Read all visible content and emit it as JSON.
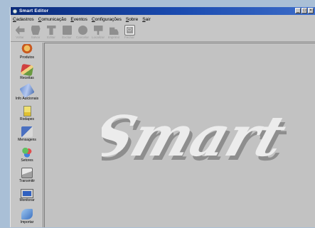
{
  "window": {
    "title": "Smart Editor"
  },
  "title_buttons": [
    "_",
    "□",
    "×"
  ],
  "menu": [
    "Cadastros",
    "Comunicação",
    "Eventos",
    "Configurações",
    "Sobre",
    "Sair"
  ],
  "toolbar": [
    {
      "label": "Voltar",
      "icon": "back-arrow-icon",
      "shape": "arrow"
    },
    {
      "label": "Salvar",
      "icon": "bag-icon",
      "shape": "bag"
    },
    {
      "label": "Editar",
      "icon": "shirt-icon",
      "shape": "doc"
    },
    {
      "label": "Excluir",
      "icon": "square-icon",
      "shape": "square"
    },
    {
      "label": "Cancelar",
      "icon": "circle-icon",
      "shape": "circle"
    },
    {
      "label": "Localizar",
      "icon": "flag-icon",
      "shape": "flag"
    },
    {
      "label": "Imprimir",
      "icon": "truck-icon",
      "shape": "truck"
    },
    {
      "label": "Fechar",
      "icon": "exit-icon",
      "shape": "exit"
    }
  ],
  "sidebar": [
    {
      "label": "Produtos",
      "icon": "produtos"
    },
    {
      "label": "Receitas",
      "icon": "receitas"
    },
    {
      "label": "Info Adicionais",
      "icon": "info"
    },
    {
      "label": "Rodapes",
      "icon": "rodapes"
    },
    {
      "label": "Mensagens",
      "icon": "mensagens"
    },
    {
      "label": "Setores",
      "icon": "setores"
    },
    {
      "label": "Transmitir",
      "icon": "transmitir"
    },
    {
      "label": "Monitorar",
      "icon": "monitorar"
    },
    {
      "label": "Importar",
      "icon": "importar"
    }
  ],
  "logo": {
    "text": "Smart",
    "color": "#ececec",
    "shadow": "#8e8e8e"
  }
}
